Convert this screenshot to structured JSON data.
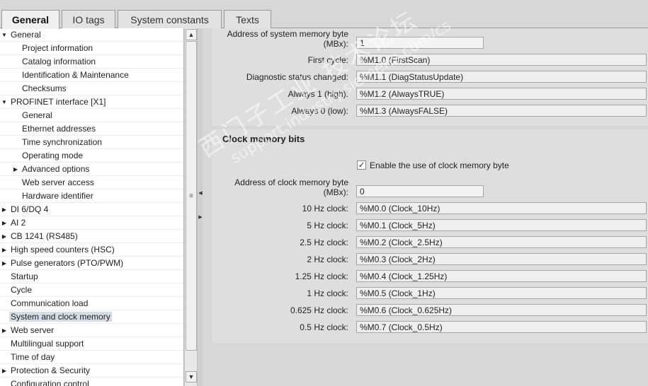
{
  "tabs": [
    "General",
    "IO tags",
    "System constants",
    "Texts"
  ],
  "tree": [
    {
      "label": "General",
      "expander": "down"
    },
    {
      "label": "Project information",
      "expander": ""
    },
    {
      "label": "Catalog information",
      "expander": ""
    },
    {
      "label": "Identification & Maintenance",
      "expander": ""
    },
    {
      "label": "Checksums",
      "expander": ""
    },
    {
      "label": "PROFINET interface [X1]",
      "expander": "down"
    },
    {
      "label": "General",
      "expander": ""
    },
    {
      "label": "Ethernet addresses",
      "expander": ""
    },
    {
      "label": "Time synchronization",
      "expander": ""
    },
    {
      "label": "Operating mode",
      "expander": ""
    },
    {
      "label": "Advanced options",
      "expander": "right"
    },
    {
      "label": "Web server access",
      "expander": ""
    },
    {
      "label": "Hardware identifier",
      "expander": ""
    },
    {
      "label": "DI 6/DQ 4",
      "expander": "right"
    },
    {
      "label": "AI 2",
      "expander": "right"
    },
    {
      "label": "CB 1241 (RS485)",
      "expander": "right"
    },
    {
      "label": "High speed counters (HSC)",
      "expander": "right"
    },
    {
      "label": "Pulse generators (PTO/PWM)",
      "expander": "right"
    },
    {
      "label": "Startup",
      "expander": ""
    },
    {
      "label": "Cycle",
      "expander": ""
    },
    {
      "label": "Communication load",
      "expander": ""
    },
    {
      "label": "System and clock memory",
      "expander": "",
      "selected": true
    },
    {
      "label": "Web server",
      "expander": "right"
    },
    {
      "label": "Multilingual support",
      "expander": ""
    },
    {
      "label": "Time of day",
      "expander": ""
    },
    {
      "label": "Protection & Security",
      "expander": "right"
    },
    {
      "label": "Configuration control",
      "expander": ""
    }
  ],
  "system_memory": {
    "address_label_line1": "Address of system memory byte",
    "address_label_line2": "(MBx):",
    "address_value": "1",
    "rows": [
      {
        "label": "First cycle:",
        "value": "%M1.0 (FirstScan)"
      },
      {
        "label": "Diagnostic status changed:",
        "value": "%M1.1 (DiagStatusUpdate)"
      },
      {
        "label": "Always 1 (high):",
        "value": "%M1.2 (AlwaysTRUE)"
      },
      {
        "label": "Always 0 (low):",
        "value": "%M1.3 (AlwaysFALSE)"
      }
    ]
  },
  "clock_memory": {
    "title": "Clock memory bits",
    "enable_label": "Enable the use of clock memory byte",
    "enable_checked": true,
    "address_label_line1": "Address of clock memory byte",
    "address_label_line2": "(MBx):",
    "address_value": "0",
    "rows": [
      {
        "label": "10 Hz clock:",
        "value": "%M0.0 (Clock_10Hz)"
      },
      {
        "label": "5 Hz clock:",
        "value": "%M0.1 (Clock_5Hz)"
      },
      {
        "label": "2.5 Hz clock:",
        "value": "%M0.2 (Clock_2.5Hz)"
      },
      {
        "label": "2 Hz clock:",
        "value": "%M0.3 (Clock_2Hz)"
      },
      {
        "label": "1.25 Hz clock:",
        "value": "%M0.4 (Clock_1.25Hz)"
      },
      {
        "label": "1 Hz clock:",
        "value": "%M0.5 (Clock_1Hz)"
      },
      {
        "label": "0.625 Hz clock:",
        "value": "%M0.6 (Clock_0.625Hz)"
      },
      {
        "label": "0.5 Hz clock:",
        "value": "%M0.7 (Clock_0.5Hz)"
      }
    ]
  },
  "watermark": {
    "line1": "西门子工业 技术论坛",
    "line2": "support.industry.siemens.com/cs"
  }
}
